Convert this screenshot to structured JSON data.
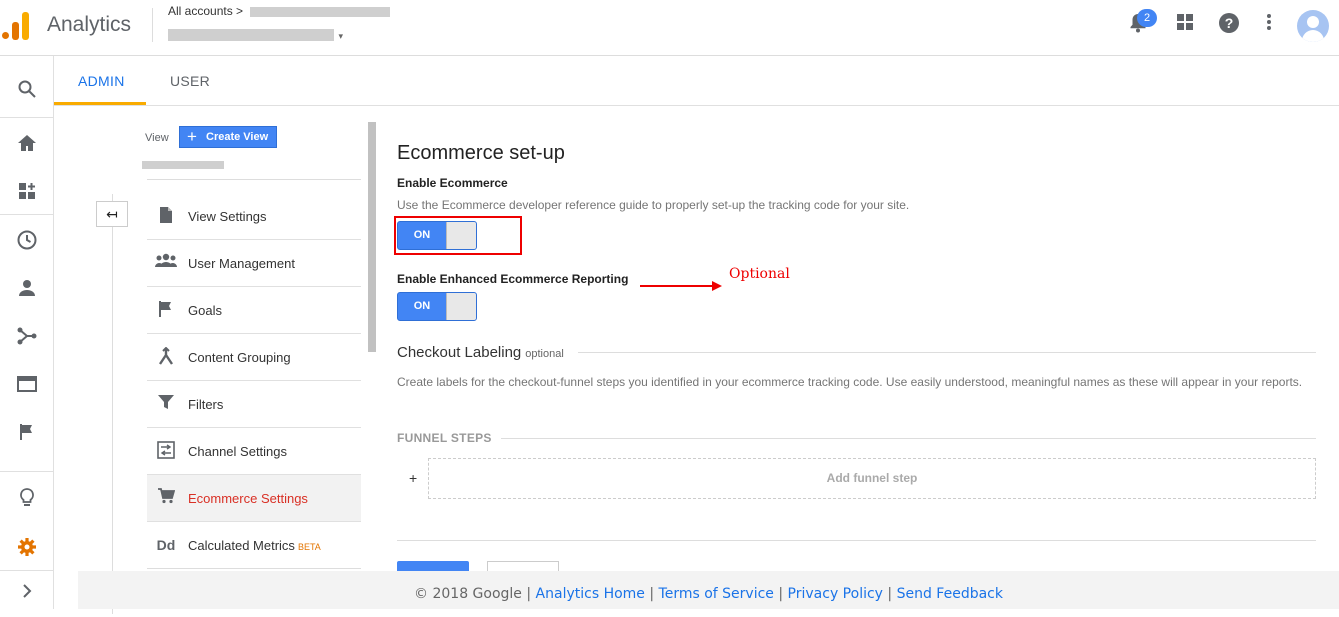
{
  "header": {
    "app_title": "Analytics",
    "account_crumb": "All accounts >",
    "notification_count": "2"
  },
  "tabs": [
    {
      "label": "ADMIN",
      "active": true
    },
    {
      "label": "USER",
      "active": false
    }
  ],
  "view_column": {
    "view_label": "View",
    "create_view_label": "Create View",
    "back_icon": "↤",
    "items": [
      {
        "label": "View Settings",
        "icon": "page-icon"
      },
      {
        "label": "User Management",
        "icon": "people-icon"
      },
      {
        "label": "Goals",
        "icon": "flag-icon"
      },
      {
        "label": "Content Grouping",
        "icon": "content-grouping-icon"
      },
      {
        "label": "Filters",
        "icon": "filter-icon"
      },
      {
        "label": "Channel Settings",
        "icon": "channel-icon"
      },
      {
        "label": "Ecommerce Settings",
        "icon": "cart-icon",
        "active": true
      },
      {
        "label": "Calculated Metrics",
        "icon": "dd-icon",
        "badge": "BETA"
      }
    ]
  },
  "main": {
    "title": "Ecommerce set-up",
    "enable_ecommerce_label": "Enable Ecommerce",
    "enable_ecommerce_desc": "Use the Ecommerce developer reference guide to properly set-up the tracking code for your site.",
    "toggle_on_label": "ON",
    "enhanced_label": "Enable Enhanced Ecommerce Reporting",
    "optional_annotation": "Optional",
    "checkout_title": "Checkout Labeling",
    "checkout_optional": "optional",
    "checkout_desc": "Create labels for the checkout-funnel steps you identified in your ecommerce tracking code. Use easily understood, meaningful names as these will appear in your reports.",
    "funnel_steps_title": "FUNNEL STEPS",
    "plus": "+",
    "add_funnel_step": "Add funnel step"
  },
  "footer": {
    "copyright": "© 2018 Google",
    "sep": "|",
    "links": [
      "Analytics Home",
      "Terms of Service",
      "Privacy Policy",
      "Send Feedback"
    ]
  },
  "colors": {
    "brand_orange": "#e37400",
    "accent_blue": "#4285f4",
    "link_blue": "#1a73e8",
    "active_red": "#d93025"
  }
}
